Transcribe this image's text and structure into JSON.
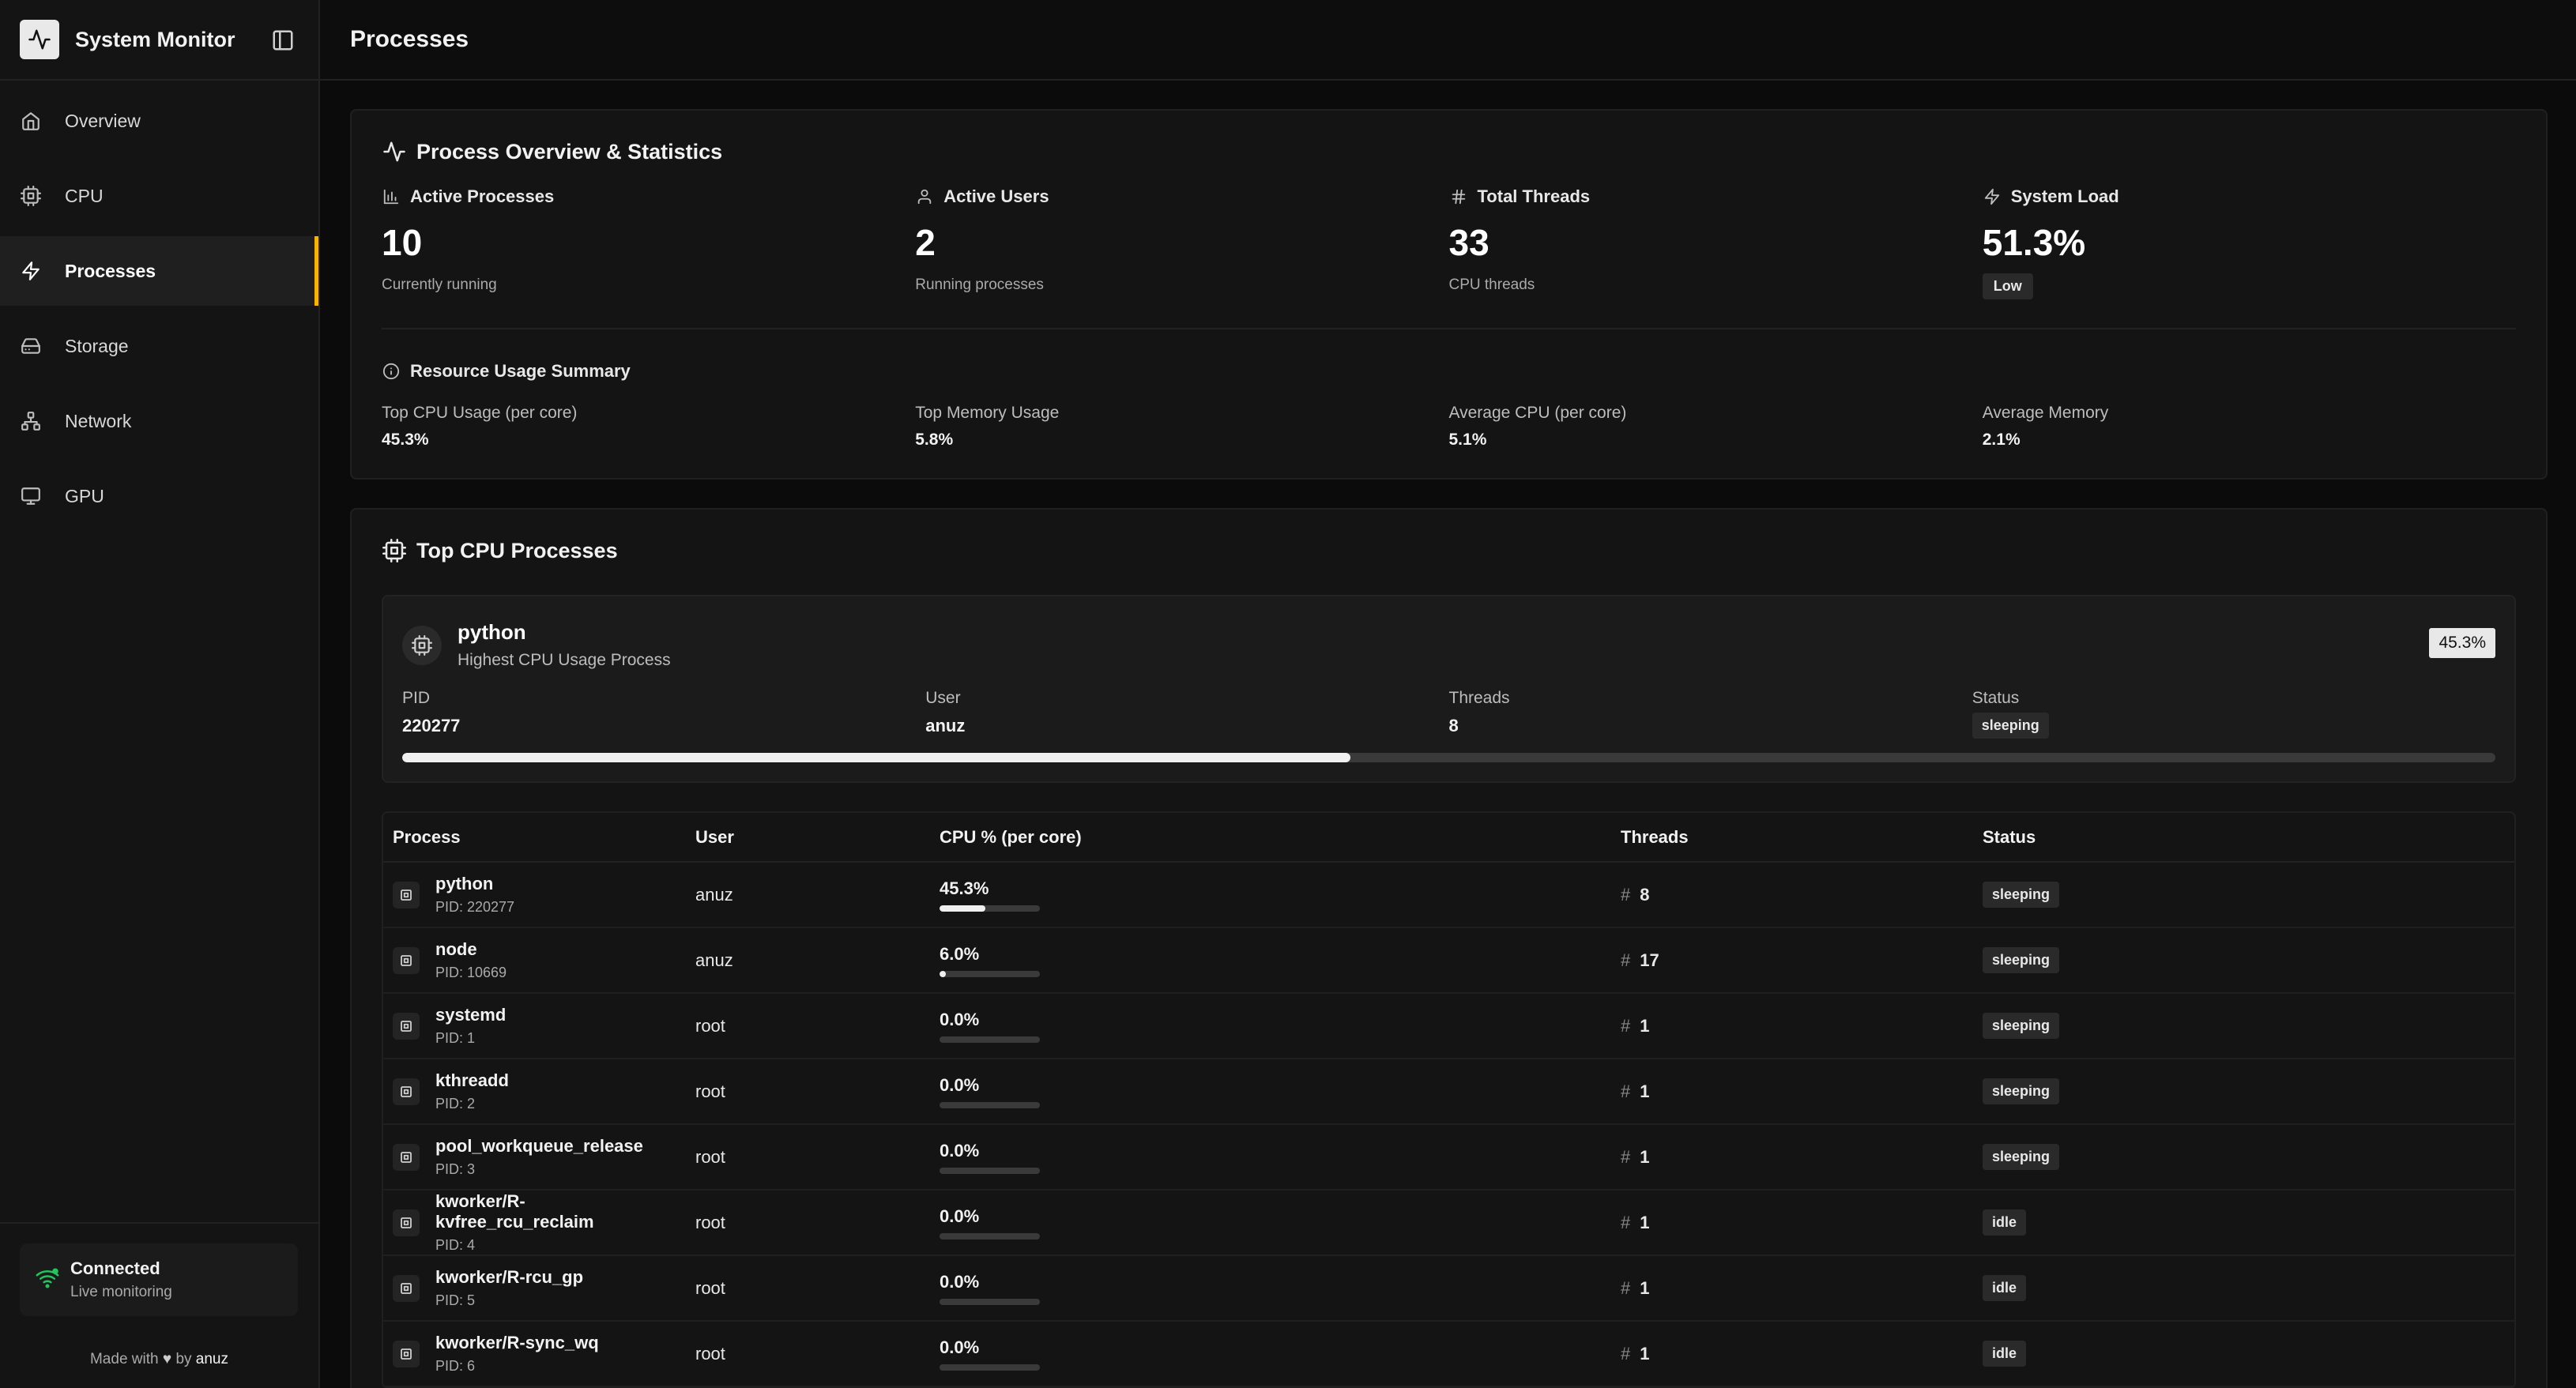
{
  "app": {
    "title": "System Monitor"
  },
  "sidebar": {
    "items": [
      {
        "label": "Overview",
        "icon": "home-icon",
        "active": false
      },
      {
        "label": "CPU",
        "icon": "cpu-icon",
        "active": false
      },
      {
        "label": "Processes",
        "icon": "zap-icon",
        "active": true
      },
      {
        "label": "Storage",
        "icon": "hard-drive-icon",
        "active": false
      },
      {
        "label": "Network",
        "icon": "network-icon",
        "active": false
      },
      {
        "label": "GPU",
        "icon": "monitor-icon",
        "active": false
      }
    ],
    "connection": {
      "title": "Connected",
      "subtitle": "Live monitoring",
      "status_color": "#22c55e"
    },
    "footer": {
      "prefix": "Made with",
      "suffix": "by",
      "author": "anuz"
    }
  },
  "header": {
    "title": "Processes"
  },
  "overview": {
    "title": "Process Overview & Statistics",
    "stats": [
      {
        "label": "Active Processes",
        "value": "10",
        "sub": "Currently running"
      },
      {
        "label": "Active Users",
        "value": "2",
        "sub": "Running processes"
      },
      {
        "label": "Total Threads",
        "value": "33",
        "sub": "CPU threads"
      },
      {
        "label": "System Load",
        "value": "51.3%",
        "badge": "Low"
      }
    ],
    "summary_title": "Resource Usage Summary",
    "summary": [
      {
        "label": "Top CPU Usage (per core)",
        "value": "45.3%"
      },
      {
        "label": "Top Memory Usage",
        "value": "5.8%"
      },
      {
        "label": "Average CPU (per core)",
        "value": "5.1%"
      },
      {
        "label": "Average Memory",
        "value": "2.1%"
      }
    ]
  },
  "top_cpu": {
    "title": "Top CPU Processes",
    "highlight": {
      "name": "python",
      "description": "Highest CPU Usage Process",
      "cpu": "45.3%",
      "cpu_fraction": 0.453,
      "pid_label": "PID",
      "pid": "220277",
      "user_label": "User",
      "user": "anuz",
      "threads_label": "Threads",
      "threads": "8",
      "status_label": "Status",
      "status": "sleeping"
    },
    "table": {
      "headers": [
        "Process",
        "User",
        "CPU % (per core)",
        "Threads",
        "Status"
      ],
      "rows": [
        {
          "name": "python",
          "pid": "PID: 220277",
          "user": "anuz",
          "cpu": "45.3%",
          "cpu_fraction": 0.453,
          "threads": "8",
          "status": "sleeping"
        },
        {
          "name": "node",
          "pid": "PID: 10669",
          "user": "anuz",
          "cpu": "6.0%",
          "cpu_fraction": 0.06,
          "threads": "17",
          "status": "sleeping"
        },
        {
          "name": "systemd",
          "pid": "PID: 1",
          "user": "root",
          "cpu": "0.0%",
          "cpu_fraction": 0,
          "threads": "1",
          "status": "sleeping"
        },
        {
          "name": "kthreadd",
          "pid": "PID: 2",
          "user": "root",
          "cpu": "0.0%",
          "cpu_fraction": 0,
          "threads": "1",
          "status": "sleeping"
        },
        {
          "name": "pool_workqueue_release",
          "pid": "PID: 3",
          "user": "root",
          "cpu": "0.0%",
          "cpu_fraction": 0,
          "threads": "1",
          "status": "sleeping"
        },
        {
          "name": "kworker/R-kvfree_rcu_reclaim",
          "pid": "PID: 4",
          "user": "root",
          "cpu": "0.0%",
          "cpu_fraction": 0,
          "threads": "1",
          "status": "idle"
        },
        {
          "name": "kworker/R-rcu_gp",
          "pid": "PID: 5",
          "user": "root",
          "cpu": "0.0%",
          "cpu_fraction": 0,
          "threads": "1",
          "status": "idle"
        },
        {
          "name": "kworker/R-sync_wq",
          "pid": "PID: 6",
          "user": "root",
          "cpu": "0.0%",
          "cpu_fraction": 0,
          "threads": "1",
          "status": "idle"
        }
      ]
    }
  }
}
